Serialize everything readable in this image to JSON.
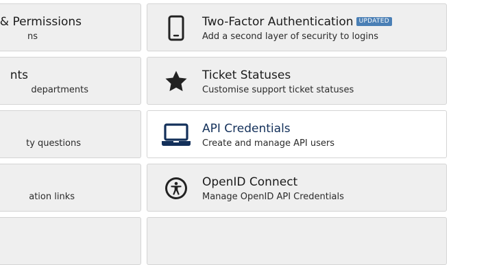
{
  "left_column": [
    {
      "title": "s & Permissions",
      "desc": "ns"
    },
    {
      "title": "nts",
      "desc": "departments"
    },
    {
      "title": "",
      "desc": "ty questions"
    },
    {
      "title": "",
      "desc": "ation links"
    }
  ],
  "right_column": [
    {
      "title": "Two-Factor Authentication",
      "badge": "UPDATED",
      "desc": "Add a second layer of security to logins",
      "icon": "mobile-phone-icon"
    },
    {
      "title": "Ticket Statuses",
      "desc": "Customise support ticket statuses",
      "icon": "star-icon"
    },
    {
      "title": "API Credentials",
      "desc": "Create and manage API users",
      "icon": "laptop-icon",
      "active": true
    },
    {
      "title": "OpenID Connect",
      "desc": "Manage OpenID API Credentials",
      "icon": "accessibility-icon"
    }
  ],
  "colors": {
    "card_bg": "#efefef",
    "card_active_bg": "#ffffff",
    "icon_color": "#222222",
    "icon_active_color": "#13305a",
    "badge_bg": "#4a7fb5"
  }
}
